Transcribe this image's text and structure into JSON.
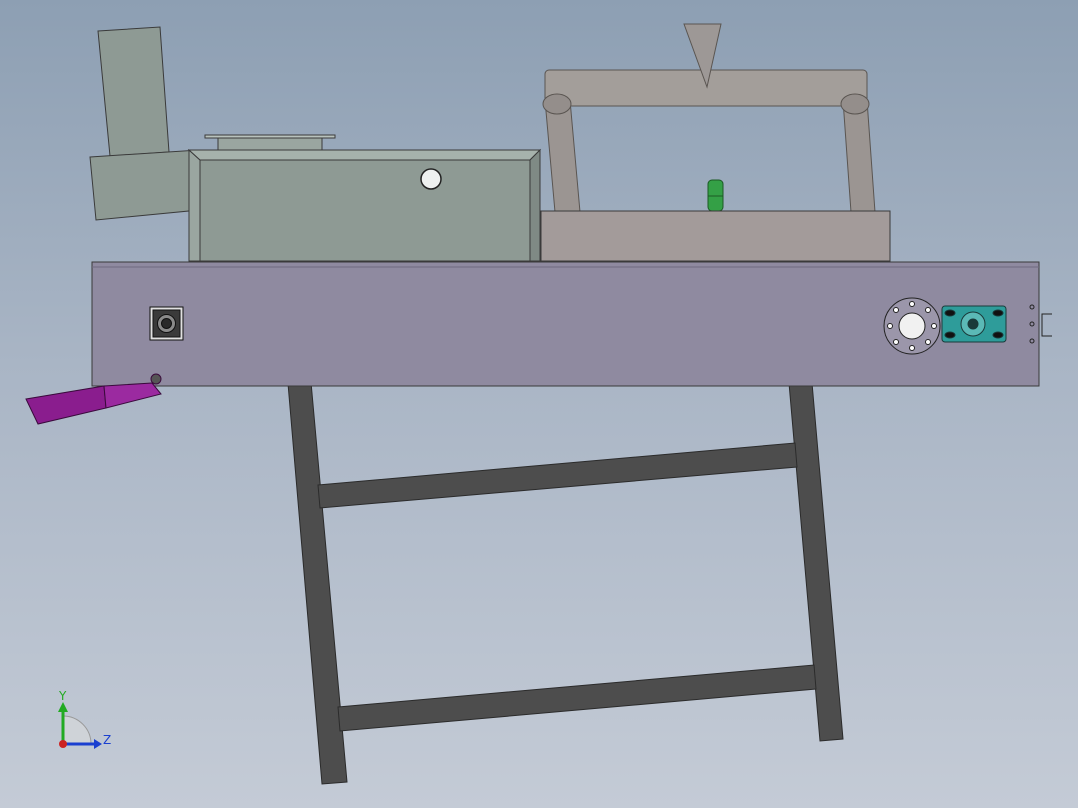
{
  "viewport": {
    "background_top": "#8d9fb3",
    "background_bottom": "#c4cbd6"
  },
  "colors": {
    "hopper": "#8e9a94",
    "base_plate": "#8f8aa0",
    "top_plate": "#a39b9a",
    "frame_tube": "#9b9592",
    "stand": "#4d4d4d",
    "handle": "#8a1d8e",
    "green_pin": "#34a046",
    "motor": "#2e9c9a",
    "outline": "#2b2b2b"
  },
  "triad": {
    "y_label": "Y",
    "z_label": "Z",
    "y_color": "#22aa22",
    "z_color": "#1a3fd0",
    "origin_color": "#cc2222"
  }
}
